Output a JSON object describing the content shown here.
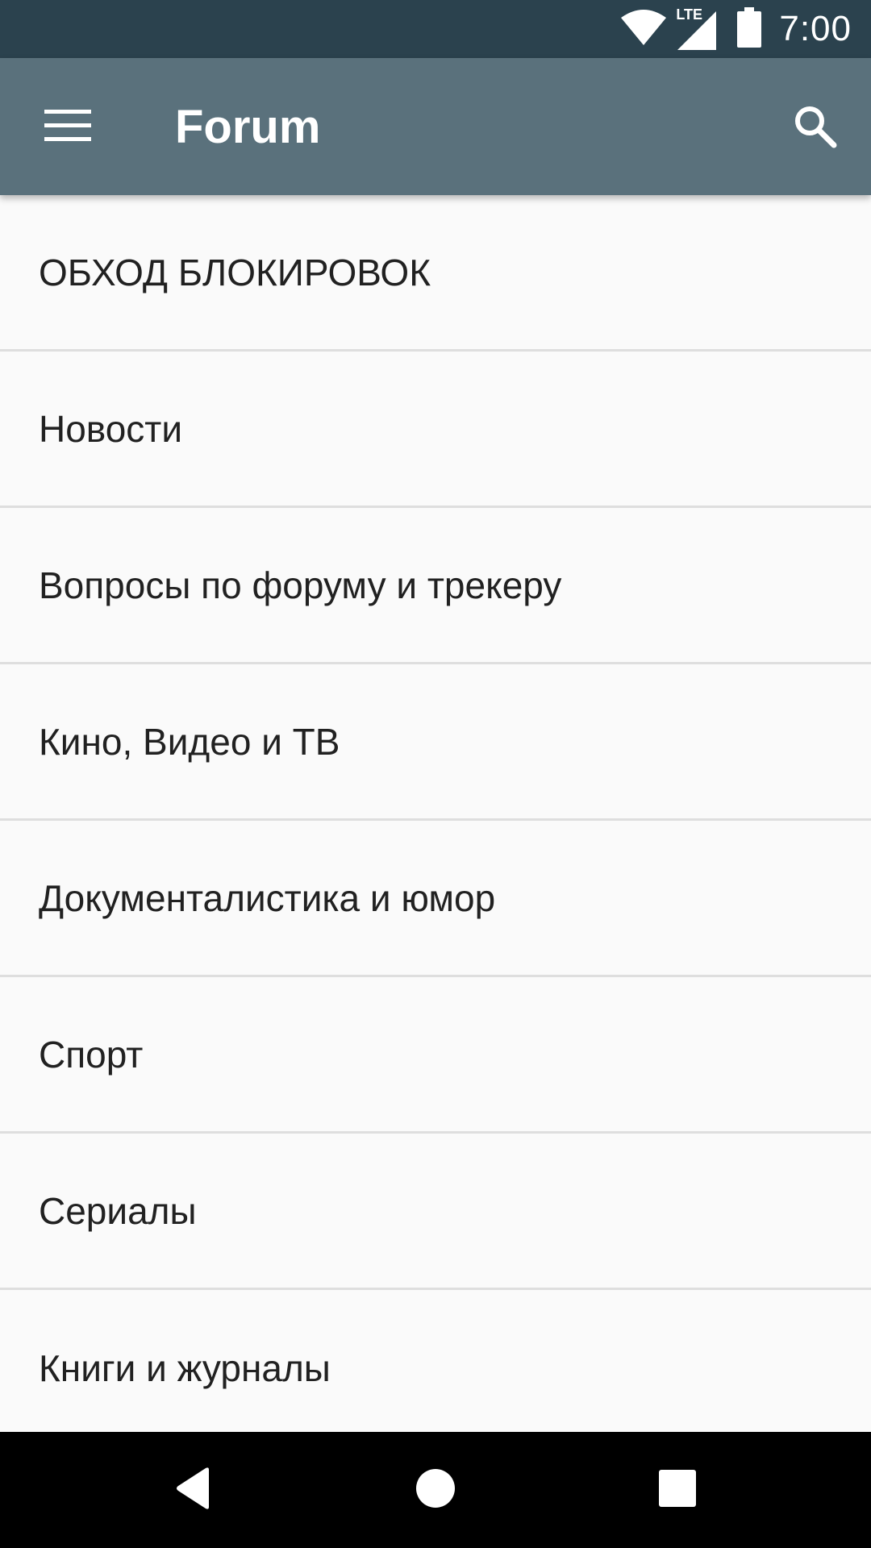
{
  "status_bar": {
    "network_label": "LTE",
    "time": "7:00",
    "icons": [
      "wifi-icon",
      "cell-signal-icon",
      "battery-icon"
    ]
  },
  "app_bar": {
    "title": "Forum",
    "menu_icon": "hamburger-menu-icon",
    "search_icon": "search-icon",
    "color": "#5a717c"
  },
  "forum_list": {
    "items": [
      {
        "label": "ОБХОД БЛОКИРОВОК"
      },
      {
        "label": "Новости"
      },
      {
        "label": "Вопросы по форуму и трекеру"
      },
      {
        "label": "Кино, Видео и ТВ"
      },
      {
        "label": "Документалистика и юмор"
      },
      {
        "label": "Спорт"
      },
      {
        "label": "Сериалы"
      },
      {
        "label": "Книги и журналы"
      }
    ]
  },
  "nav_bar": {
    "buttons": [
      "back-icon",
      "home-icon",
      "recents-icon"
    ]
  },
  "colors": {
    "status_bar": "#2b424e",
    "app_bar": "#5a717c",
    "background": "#fafafa",
    "divider": "#dedede",
    "text": "#212121"
  }
}
